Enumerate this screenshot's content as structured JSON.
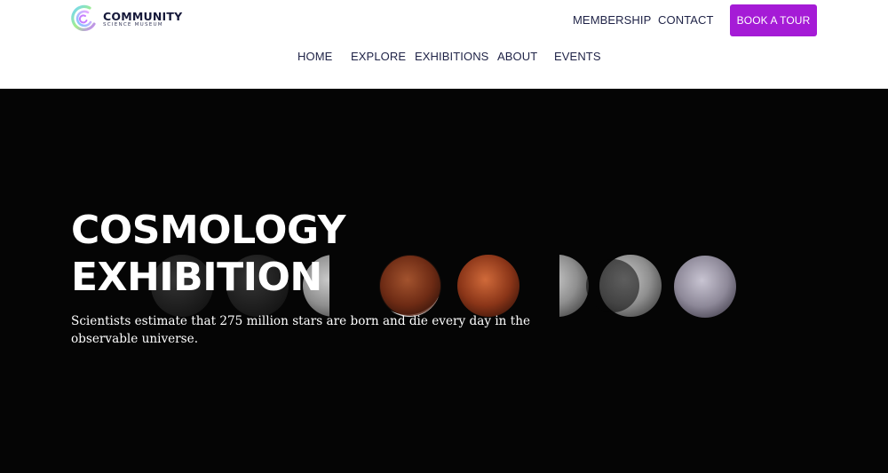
{
  "brand": {
    "name": "COMMUNITY",
    "subtitle": "SCIENCE MUSEUM",
    "logo_icon": "swirl-logo-icon",
    "logo_colors": [
      "#6fd4ff",
      "#a3ef8a",
      "#c77dff",
      "#f2a5ff"
    ]
  },
  "utility_nav": {
    "membership": "MEMBERSHIP",
    "contact": "CONTACT",
    "book_tour": "BOOK A TOUR"
  },
  "main_nav": {
    "items": [
      {
        "label": "HOME"
      },
      {
        "label": "EXPLORE"
      },
      {
        "label": "EXHIBITIONS"
      },
      {
        "label": "ABOUT"
      },
      {
        "label": "EVENTS"
      }
    ]
  },
  "hero": {
    "title_line1": "COSMOLOGY",
    "title_line2": "EXHIBITION",
    "description": "Scientists estimate that 275 million stars are born and die every day in the observable universe.",
    "background_image": "lunar-eclipse-phases",
    "background_color": "#050505"
  },
  "colors": {
    "accent": "#a51bd6",
    "nav_text": "#1f2347",
    "header_bg": "#ffffff",
    "hero_text": "#ffffff"
  }
}
